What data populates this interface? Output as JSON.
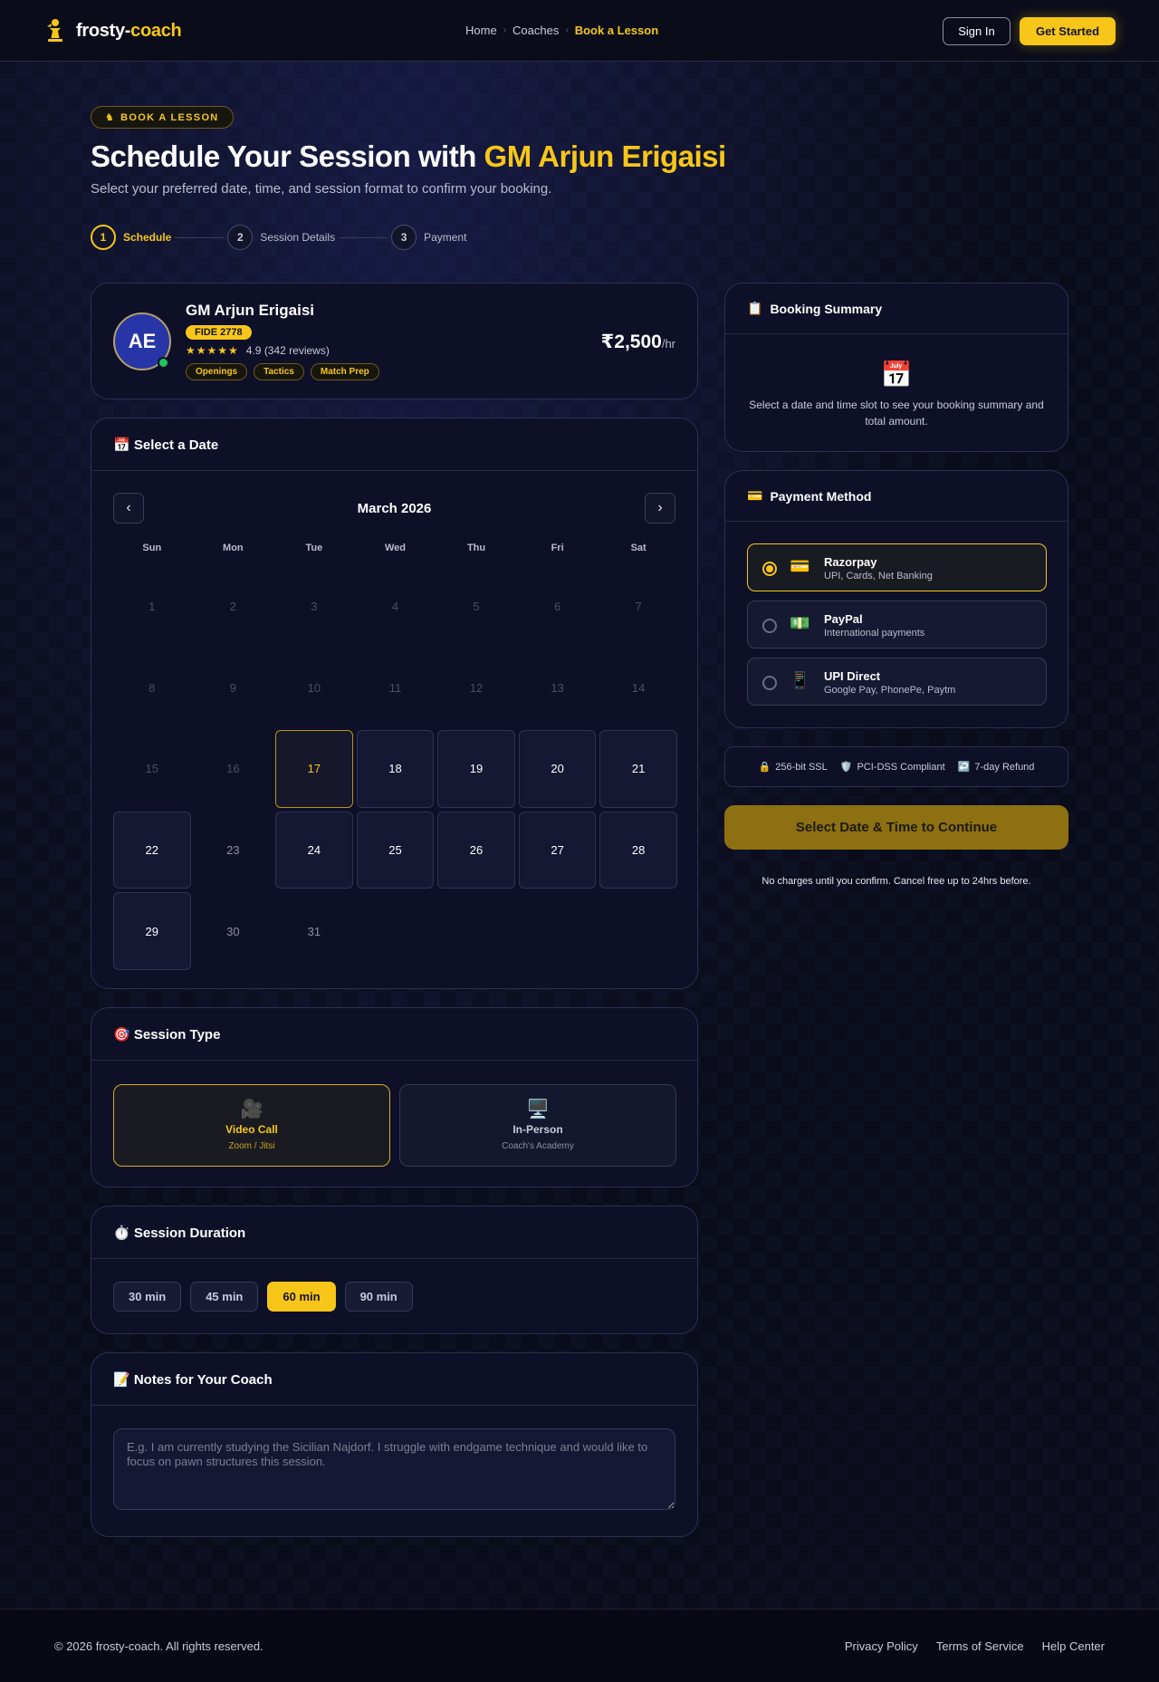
{
  "brand": {
    "part1": "frosty-",
    "part2": "coach",
    "icon": "chess-pawn-icon",
    "accent": "#f7c619"
  },
  "nav": {
    "breadcrumbs": [
      "Home",
      "Coaches",
      "Book a Lesson"
    ],
    "signin": "Sign In",
    "get_started": "Get Started"
  },
  "hero": {
    "pill": "BOOK A LESSON",
    "pill_icon": "♞",
    "title_prefix": "Schedule Your Session with ",
    "title_highlight": "GM Arjun Erigaisi",
    "subtitle": "Select your preferred date, time, and session format to confirm your booking."
  },
  "steps": [
    {
      "num": "1",
      "label": "Schedule",
      "active": true
    },
    {
      "num": "2",
      "label": "Session Details",
      "active": false
    },
    {
      "num": "3",
      "label": "Payment",
      "active": false
    }
  ],
  "coach": {
    "initials": "AE",
    "name": "GM Arjun Erigaisi",
    "fide": "FIDE 2778",
    "stars": "★★★★★",
    "rating": "4.9 (342 reviews)",
    "tags": [
      "Openings",
      "Tactics",
      "Match Prep"
    ],
    "price": "₹2,500",
    "price_unit": "/hr"
  },
  "calendar": {
    "title": "📅 Select a Date",
    "month": "March 2026",
    "prev": "‹",
    "next": "›",
    "weekdays": [
      "Sun",
      "Mon",
      "Tue",
      "Wed",
      "Thu",
      "Fri",
      "Sat"
    ],
    "days": [
      {
        "d": "1",
        "s": "past"
      },
      {
        "d": "2",
        "s": "past"
      },
      {
        "d": "3",
        "s": "past"
      },
      {
        "d": "4",
        "s": "past"
      },
      {
        "d": "5",
        "s": "past"
      },
      {
        "d": "6",
        "s": "past"
      },
      {
        "d": "7",
        "s": "past"
      },
      {
        "d": "8",
        "s": "past"
      },
      {
        "d": "9",
        "s": "past"
      },
      {
        "d": "10",
        "s": "past"
      },
      {
        "d": "11",
        "s": "past"
      },
      {
        "d": "12",
        "s": "past"
      },
      {
        "d": "13",
        "s": "past"
      },
      {
        "d": "14",
        "s": "past"
      },
      {
        "d": "15",
        "s": "past"
      },
      {
        "d": "16",
        "s": "past"
      },
      {
        "d": "17",
        "s": "today"
      },
      {
        "d": "18",
        "s": "avail"
      },
      {
        "d": "19",
        "s": "avail"
      },
      {
        "d": "20",
        "s": "avail"
      },
      {
        "d": "21",
        "s": "avail"
      },
      {
        "d": "22",
        "s": "avail"
      },
      {
        "d": "23",
        "s": "unavail"
      },
      {
        "d": "24",
        "s": "avail"
      },
      {
        "d": "25",
        "s": "avail"
      },
      {
        "d": "26",
        "s": "avail"
      },
      {
        "d": "27",
        "s": "avail"
      },
      {
        "d": "28",
        "s": "avail"
      },
      {
        "d": "29",
        "s": "avail"
      },
      {
        "d": "30",
        "s": "unavail"
      },
      {
        "d": "31",
        "s": "unavail"
      }
    ]
  },
  "session_type": {
    "title": "🎯 Session Type",
    "options": [
      {
        "icon": "🎥",
        "label": "Video Call",
        "sub": "Zoom / Jitsi",
        "selected": true
      },
      {
        "icon": "🖥️",
        "label": "In-Person",
        "sub": "Coach's Academy",
        "selected": false
      }
    ]
  },
  "duration": {
    "title": "⏱️ Session Duration",
    "options": [
      {
        "label": "30 min",
        "selected": false
      },
      {
        "label": "45 min",
        "selected": false
      },
      {
        "label": "60 min",
        "selected": true
      },
      {
        "label": "90 min",
        "selected": false
      }
    ]
  },
  "notes": {
    "title": "📝 Notes for Your Coach",
    "placeholder": "E.g. I am currently studying the Sicilian Najdorf. I struggle with endgame technique and would like to focus on pawn structures this session.",
    "value": ""
  },
  "summary": {
    "icon": "📋",
    "title": "Booking Summary",
    "empty_icon": "📅",
    "empty_text": "Select a date and time slot to see your booking summary and total amount."
  },
  "payment": {
    "icon": "💳",
    "title": "Payment Method",
    "options": [
      {
        "icon": "💳",
        "name": "Razorpay",
        "desc": "UPI, Cards, Net Banking",
        "selected": true
      },
      {
        "icon": "💵",
        "name": "PayPal",
        "desc": "International payments",
        "selected": false
      },
      {
        "icon": "📱",
        "name": "UPI Direct",
        "desc": "Google Pay, PhonePe, Paytm",
        "selected": false
      }
    ]
  },
  "trust": [
    {
      "icon": "🔒",
      "label": "256-bit SSL"
    },
    {
      "icon": "🛡️",
      "label": "PCI-DSS Compliant"
    },
    {
      "icon": "↩️",
      "label": "7-day Refund"
    }
  ],
  "cta": "Select Date & Time to Continue",
  "cta_note": "No charges until you confirm. Cancel free up to 24hrs before.",
  "footer": {
    "copyright": "© 2026 frosty-coach. All rights reserved.",
    "links": [
      "Privacy Policy",
      "Terms of Service",
      "Help Center"
    ]
  }
}
